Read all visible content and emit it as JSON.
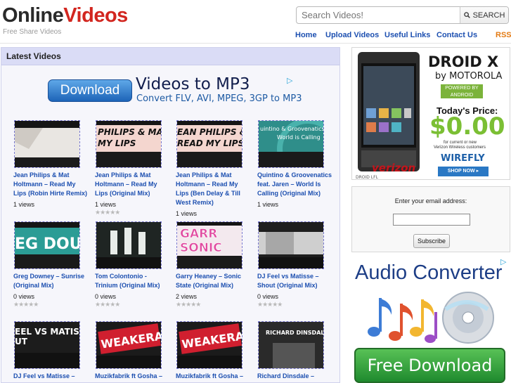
{
  "logo": {
    "part1": "Online",
    "part2": "Videos",
    "tagline": "Free Share Videos"
  },
  "search": {
    "placeholder": "Search Videos!",
    "button_label": "SEARCH",
    "button_icon": "magnifier-icon"
  },
  "nav": {
    "home": "Home",
    "upload": "Upload Videos",
    "links": "Useful Links",
    "contact": "Contact Us",
    "rss": "RSS"
  },
  "main": {
    "heading": "Latest Videos"
  },
  "top_ad": {
    "button": "Download",
    "title": "Videos to MP3",
    "subtitle": "Convert FLV, AVI, MPEG, 3GP to MP3",
    "mark": "▷"
  },
  "videos": [
    {
      "title": "Jean Philips & Mat Holtmann – Read My Lips (Robin Hirte Remix)",
      "views": "1 views",
      "thumb_text": ""
    },
    {
      "title": "Jean Philips & Mat Holtmann – Read My Lips (Original Mix)",
      "views": "1 views",
      "thumb_text": "PHILIPS & MAT MY LIPS"
    },
    {
      "title": "Jean Philips & Mat Holtmann – Read My Lips (Ben Delay & Till West Remix)",
      "views": "1 views",
      "thumb_text": "EAN PHILIPS & READ MY LIPS"
    },
    {
      "title": "Quintino & Groovenatics feat. Jaren – World Is Calling (Original Mix)",
      "views": "1 views",
      "thumb_text": "uintino & Groovenatics World is Calling"
    },
    {
      "title": "Greg Downey – Sunrise (Original Mix)",
      "views": "0 views",
      "thumb_text": "EG DOU"
    },
    {
      "title": "Tom Colontonio - Trinium (Original Mix)",
      "views": "0 views",
      "thumb_text": ""
    },
    {
      "title": "Garry Heaney – Sonic State (Original Mix)",
      "views": "2 views",
      "thumb_text": "GARR SONIC"
    },
    {
      "title": "DJ Feel vs Matisse – Shout (Original Mix)",
      "views": "0 views",
      "thumb_text": ""
    },
    {
      "title": "DJ Feel vs Matisse – Shout (Cosy Remix)",
      "views": "",
      "thumb_text": "EEL VS MATISSE UT"
    },
    {
      "title": "Muzikfabrik ft Gosha – Volt (Original Mix)",
      "views": "",
      "thumb_text": "WEAKERA"
    },
    {
      "title": "Muzikfabrik ft Gosha – Volt (Dub Mix)",
      "views": "",
      "thumb_text": "WEAKERA"
    },
    {
      "title": "Richard Dinsdale – Shake Her (Original Mix)",
      "views": "",
      "thumb_text": "RICHARD DINSDALE"
    }
  ],
  "stars_text": "★★★★★",
  "side_ad1": {
    "brand": "DROID X",
    "by": "by MOTOROLA",
    "powered": "POWERED BY ANDROID",
    "price_label": "Today's Price:",
    "price": "$0.00",
    "fine1": "for current or new",
    "fine2": "Verizon Wireless customers",
    "wirefly": "WIREFLY",
    "shop": "SHOP NOW ▸",
    "carrier": "verizon",
    "model": "DROID LFL"
  },
  "newsletter": {
    "label": "Enter your email address:",
    "button": "Subscribe"
  },
  "side_ad2": {
    "title": "Audio Converter",
    "mark": "▷",
    "button": "Free Download"
  },
  "colors": {
    "link": "#1c4fb0",
    "brand_red": "#d2261f",
    "rss": "#e37a12",
    "panel_head": "#dadcf6"
  }
}
